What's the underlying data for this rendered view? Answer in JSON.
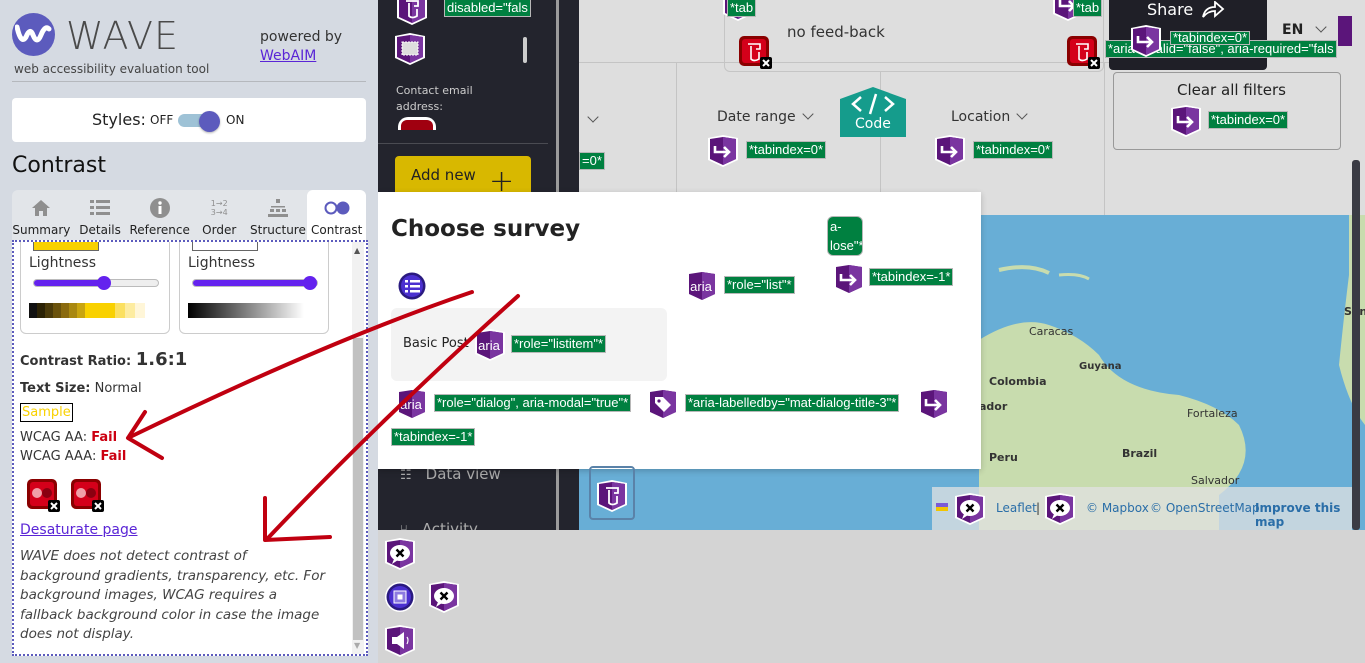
{
  "wave": {
    "title": "WAVE",
    "subtitle": "web accessibility evaluation tool",
    "powered_by": "powered by",
    "powered_link": "WebAIM",
    "styles_label": "Styles:",
    "styles_off": "OFF",
    "styles_on": "ON",
    "styles_enabled": true,
    "panel_title": "Contrast",
    "tabs": [
      {
        "label": "Summary",
        "icon": "home-icon"
      },
      {
        "label": "Details",
        "icon": "list-icon"
      },
      {
        "label": "Reference",
        "icon": "info-icon"
      },
      {
        "label": "Order",
        "icon": "order-icon"
      },
      {
        "label": "Structure",
        "icon": "structure-icon"
      },
      {
        "label": "Contrast",
        "icon": "contrast-icon",
        "active": true
      }
    ],
    "contrast": {
      "foreground": {
        "label": "Lightness",
        "color": "#f9d100",
        "lightness_percent": 58
      },
      "background": {
        "label": "Lightness",
        "color": "#ffffff",
        "lightness_percent": 100
      },
      "ratio_label": "Contrast Ratio:",
      "ratio_value": "1.6:1",
      "text_size_label": "Text Size:",
      "text_size_value": "Normal",
      "sample": "Sample",
      "aa_label": "WCAG AA:",
      "aa_value": "Fail",
      "aaa_label": "WCAG AAA:",
      "aaa_value": "Fail",
      "error_count": 2,
      "desaturate_link": "Desaturate page",
      "note": "WAVE does not detect contrast of background gradients, transparency, etc. For background images, WCAG requires a fallback background color in case the image does not display."
    }
  },
  "page": {
    "nav": {
      "contact_label": "Contact email address:",
      "add_new": "Add new",
      "data_view": "Data view",
      "activity": "Activity"
    },
    "feedback": "no feed-back",
    "filters": {
      "date_range": "Date range",
      "location": "Location",
      "clear_all": "Clear all filters"
    },
    "share": "Share",
    "language": "EN",
    "dialog": {
      "title": "Choose survey",
      "list_item": "Basic Post"
    },
    "map": {
      "labels": [
        "Caracas",
        "Guyana",
        "Colombia",
        "ador",
        "Fortaleza",
        "Peru",
        "Brazil",
        "Salvador",
        "Sene"
      ],
      "attribution": {
        "leaflet": "Leaflet",
        "separator": "|",
        "mapbox": "© Mapbox",
        "osm": "© OpenStreetMap",
        "improve": "Improve this map"
      }
    },
    "code_button": "Code"
  },
  "annotations": {
    "disabled": "disabled=\"fals",
    "tab_trunc": "*tab",
    "tabindex0": "*tabindex=0*",
    "tabindex0_trunc": "=0*",
    "tabindex_neg": "*tabindex=-1*",
    "aria_invalid": "*aria-invalid=\"false\", aria-required=\"fals",
    "aria_close": "a-\nlose\"*",
    "role_list": "*role=\"list\"*",
    "role_listitem": "*role=\"listitem\"*",
    "role_dialog": "*role=\"dialog\", aria-modal=\"true\"*",
    "aria_labelledby": "*aria-labelledby=\"mat-dialog-title-3\"*",
    "aria_icon_text": "aria"
  },
  "colors": {
    "wave_purple": "#5c5bbd",
    "annotation_green": "#008040",
    "error_red": "#cc0011",
    "link_purple": "#5a25d6",
    "icon_purple": "#5b157a",
    "code_teal": "#159c8c"
  }
}
